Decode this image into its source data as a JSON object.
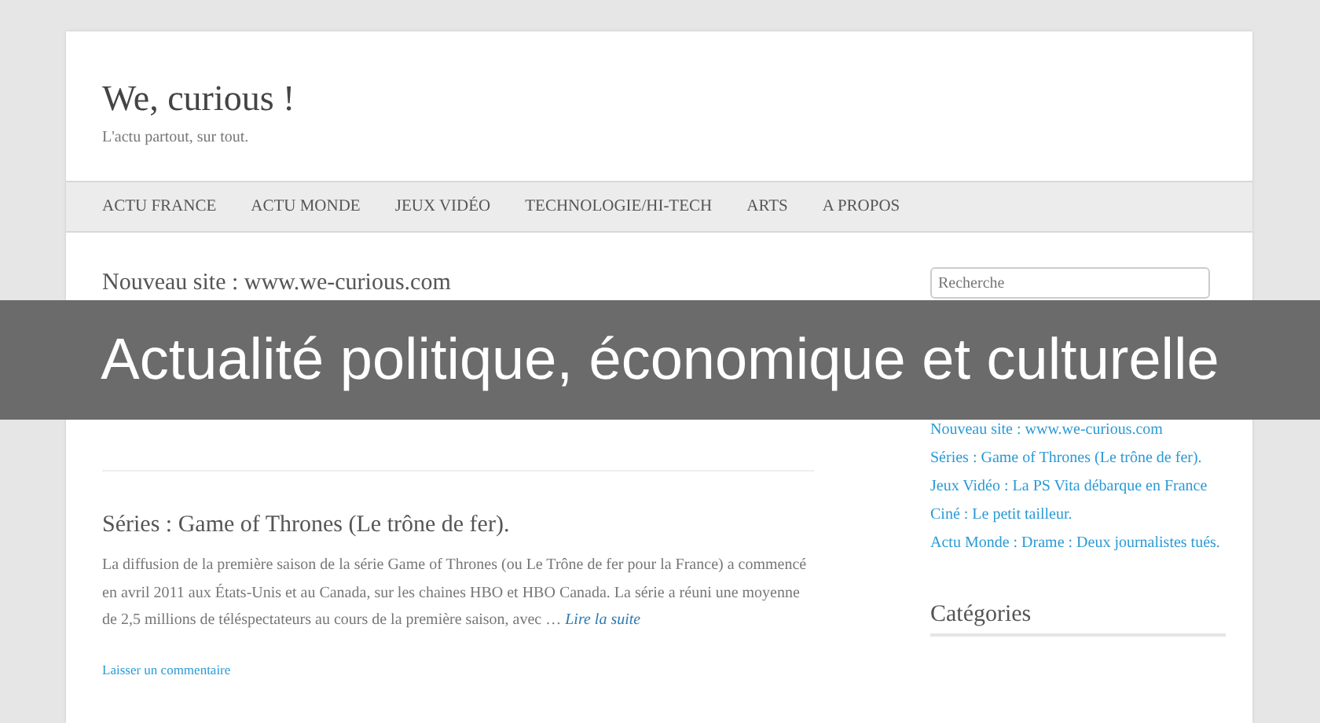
{
  "site": {
    "title": "We, curious !",
    "tagline": "L'actu partout, sur tout."
  },
  "nav": [
    {
      "label": "ACTU FRANCE"
    },
    {
      "label": "ACTU MONDE"
    },
    {
      "label": "JEUX VIDÉO"
    },
    {
      "label": "TECHNOLOGIE/HI-TECH"
    },
    {
      "label": "ARTS"
    },
    {
      "label": "A PROPOS"
    }
  ],
  "posts": [
    {
      "title": "Nouveau site : www.we-curious.com"
    },
    {
      "title": "Séries : Game of Thrones (Le trône de fer).",
      "excerpt": "La diffusion de la première saison de la série Game of Thrones (ou Le Trône de fer pour la France) a commencé en avril 2011 aux États-Unis et au Canada, sur les chaines HBO et HBO Canada. La série a réuni une moyenne de 2,5 millions de téléspectateurs au cours de la première saison, avec … ",
      "read_more": "Lire la suite",
      "comment_link": "Laisser un commentaire"
    }
  ],
  "sidebar": {
    "search": {
      "placeholder": "Recherche"
    },
    "recent": [
      "Nouveau site : www.we-curious.com",
      "Séries : Game of Thrones (Le trône de fer).",
      "Jeux Vidéo : La PS Vita débarque en France",
      "Ciné : Le petit tailleur.",
      "Actu Monde : Drame : Deux journalistes tués."
    ],
    "categories_heading": "Catégories"
  },
  "overlay_caption": "Actualité politique, économique et culturelle"
}
